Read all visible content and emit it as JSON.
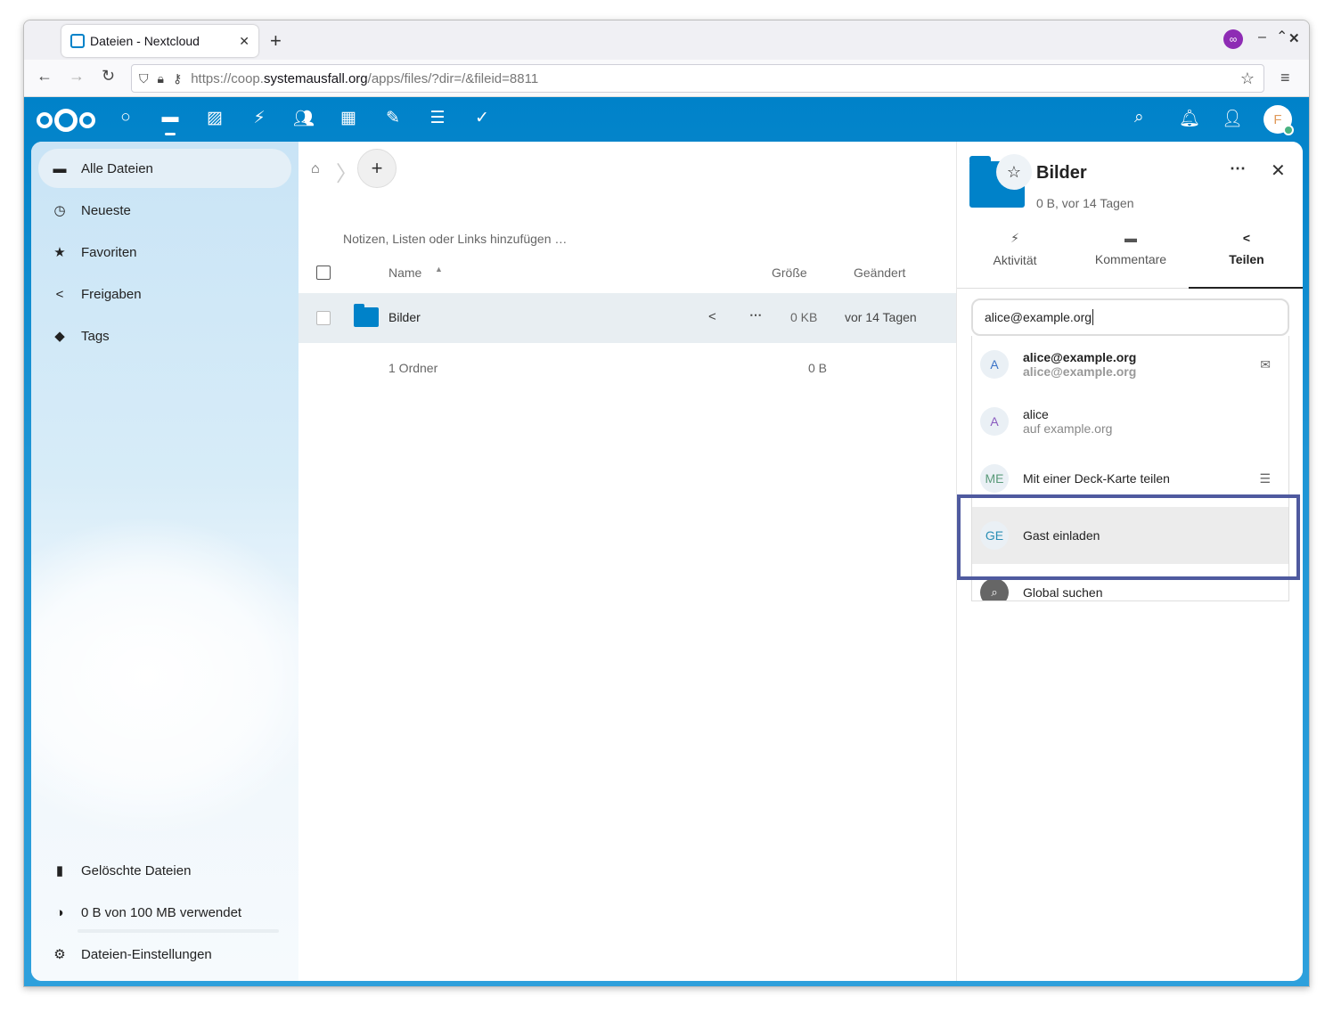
{
  "browser": {
    "tab_title": "Dateien - Nextcloud",
    "tab_close": "✕",
    "new_tab": "+",
    "url_prefix": "https://coop.",
    "url_host": "systemausfall.org",
    "url_path": "/apps/files/?dir=/&fileid=8811",
    "back": "←",
    "forward": "→",
    "reload": "↻",
    "menu": "≡",
    "bookmark": "☆",
    "min": "–",
    "max": "⌃",
    "close": "✕"
  },
  "nc_header": {
    "avatar_letter": "F"
  },
  "nav": {
    "items": [
      {
        "label": "Alle Dateien",
        "icon": "folder-icon",
        "glyph": "▬"
      },
      {
        "label": "Neueste",
        "icon": "clock-icon",
        "glyph": "◷"
      },
      {
        "label": "Favoriten",
        "icon": "star-icon",
        "glyph": "★"
      },
      {
        "label": "Freigaben",
        "icon": "share-icon",
        "glyph": "<"
      },
      {
        "label": "Tags",
        "icon": "tag-icon",
        "glyph": "◆"
      }
    ],
    "bottom": [
      {
        "label": "Gelöschte Dateien",
        "icon": "trash-icon",
        "glyph": "▮"
      },
      {
        "label": "0 B von 100 MB verwendet",
        "icon": "pie-chart-icon",
        "glyph": "◑"
      },
      {
        "label": "Dateien-Einstellungen",
        "icon": "gear-icon",
        "glyph": "⚙"
      }
    ]
  },
  "files": {
    "notes_placeholder": "Notizen, Listen oder Links hinzufügen …",
    "columns": {
      "name": "Name",
      "size": "Größe",
      "modified": "Geändert"
    },
    "rows": [
      {
        "name": "Bilder",
        "size": "0 KB",
        "modified": "vor 14 Tagen"
      }
    ],
    "summary": {
      "count": "1 Ordner",
      "size": "0 B"
    }
  },
  "sidebar": {
    "title": "Bilder",
    "subtitle": "0 B, vor 14 Tagen",
    "tabs": [
      {
        "label": "Aktivität",
        "icon": "bolt-icon"
      },
      {
        "label": "Kommentare",
        "icon": "comment-icon"
      },
      {
        "label": "Teilen",
        "icon": "share-icon"
      }
    ],
    "share_input_value": "alice@example.org",
    "options": [
      {
        "avatar": "A",
        "title": "alice@example.org",
        "subtitle": "alice@example.org",
        "icon": "mail-icon"
      },
      {
        "avatar": "A",
        "title": "alice",
        "subtitle": "auf example.org",
        "icon": ""
      },
      {
        "avatar": "ME",
        "title": "Mit einer Deck-Karte teilen",
        "subtitle": "",
        "icon": "deck-icon"
      },
      {
        "avatar": "GE",
        "title": "Gast einladen",
        "subtitle": "",
        "icon": ""
      },
      {
        "avatar": "",
        "title": "Global suchen",
        "subtitle": "",
        "icon": "search-icon"
      }
    ]
  },
  "colors": {
    "brand": "#0082c9",
    "highlight_border": "#4f5a9f"
  }
}
